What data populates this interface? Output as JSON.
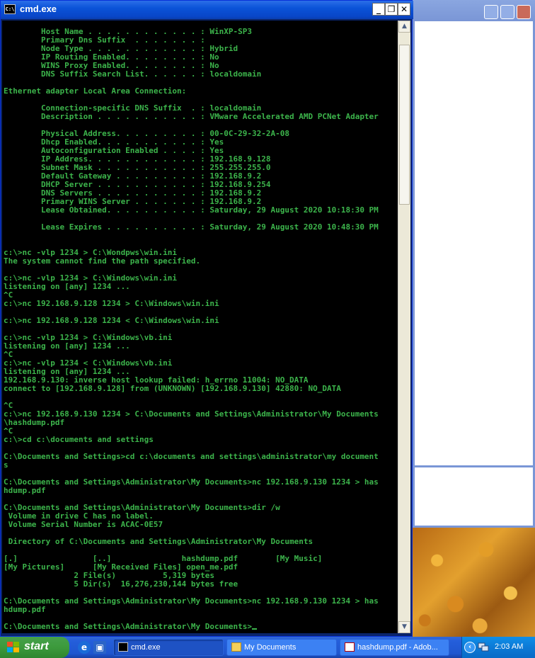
{
  "cmd_window": {
    "title": "cmd.exe",
    "icon_text": "C:\\",
    "lines": [
      "        Host Name . . . . . . . . . . . . : WinXP-SP3",
      "        Primary Dns Suffix  . . . . . . . :",
      "        Node Type . . . . . . . . . . . . : Hybrid",
      "        IP Routing Enabled. . . . . . . . : No",
      "        WINS Proxy Enabled. . . . . . . . : No",
      "        DNS Suffix Search List. . . . . . : localdomain",
      "",
      "Ethernet adapter Local Area Connection:",
      "",
      "        Connection-specific DNS Suffix  . : localdomain",
      "        Description . . . . . . . . . . . : VMware Accelerated AMD PCNet Adapter",
      "",
      "        Physical Address. . . . . . . . . : 00-0C-29-32-2A-08",
      "        Dhcp Enabled. . . . . . . . . . . : Yes",
      "        Autoconfiguration Enabled . . . . : Yes",
      "        IP Address. . . . . . . . . . . . : 192.168.9.128",
      "        Subnet Mask . . . . . . . . . . . : 255.255.255.0",
      "        Default Gateway . . . . . . . . . : 192.168.9.2",
      "        DHCP Server . . . . . . . . . . . : 192.168.9.254",
      "        DNS Servers . . . . . . . . . . . : 192.168.9.2",
      "        Primary WINS Server . . . . . . . : 192.168.9.2",
      "        Lease Obtained. . . . . . . . . . : Saturday, 29 August 2020 10:18:30 PM",
      "",
      "        Lease Expires . . . . . . . . . . : Saturday, 29 August 2020 10:48:30 PM",
      "",
      "",
      "c:\\>nc -vlp 1234 > C:\\Wondpws\\win.ini",
      "The system cannot find the path specified.",
      "",
      "c:\\>nc -vlp 1234 > C:\\Windows\\win.ini",
      "listening on [any] 1234 ...",
      "^C",
      "c:\\>nc 192.168.9.128 1234 > C:\\Windows\\win.ini",
      "",
      "c:\\>nc 192.168.9.128 1234 < C:\\Windows\\win.ini",
      "",
      "c:\\>nc -vlp 1234 > C:\\Windows\\vb.ini",
      "listening on [any] 1234 ...",
      "^C",
      "c:\\>nc -vlp 1234 < C:\\Windows\\vb.ini",
      "listening on [any] 1234 ...",
      "192.168.9.130: inverse host lookup failed: h_errno 11004: NO_DATA",
      "connect to [192.168.9.128] from (UNKNOWN) [192.168.9.130] 42880: NO_DATA",
      "",
      "^C",
      "c:\\>nc 192.168.9.130 1234 > C:\\Documents and Settings\\Administrator\\My Documents",
      "\\hashdump.pdf",
      "^C",
      "c:\\>cd c:\\documents and settings",
      "",
      "C:\\Documents and Settings>cd c:\\documents and settings\\administrator\\my document",
      "s",
      "",
      "C:\\Documents and Settings\\Administrator\\My Documents>nc 192.168.9.130 1234 > has",
      "hdump.pdf",
      "",
      "C:\\Documents and Settings\\Administrator\\My Documents>dir /w",
      " Volume in drive C has no label.",
      " Volume Serial Number is ACAC-0E57",
      "",
      " Directory of C:\\Documents and Settings\\Administrator\\My Documents",
      "",
      "[.]                [..]               hashdump.pdf        [My Music]",
      "[My Pictures]      [My Received Files] open_me.pdf",
      "               2 File(s)          5,319 bytes",
      "               5 Dir(s)  16,276,230,144 bytes free",
      "",
      "C:\\Documents and Settings\\Administrator\\My Documents>nc 192.168.9.130 1234 > has",
      "hdump.pdf",
      "",
      "C:\\Documents and Settings\\Administrator\\My Documents>"
    ]
  },
  "taskbar": {
    "start_label": "start",
    "tasks": [
      {
        "label": "cmd.exe",
        "icon": "cmd-icon",
        "active": true
      },
      {
        "label": "My Documents",
        "icon": "folder-icon",
        "active": false
      },
      {
        "label": "hashdump.pdf - Adob...",
        "icon": "pdf-icon",
        "active": false
      }
    ],
    "clock": "2:03 AM"
  },
  "colors": {
    "console_text": "#3cb44b",
    "console_bg": "#000000",
    "title_bar": "#0a53d8",
    "taskbar": "#245edb",
    "start_button": "#3c9a3c"
  }
}
